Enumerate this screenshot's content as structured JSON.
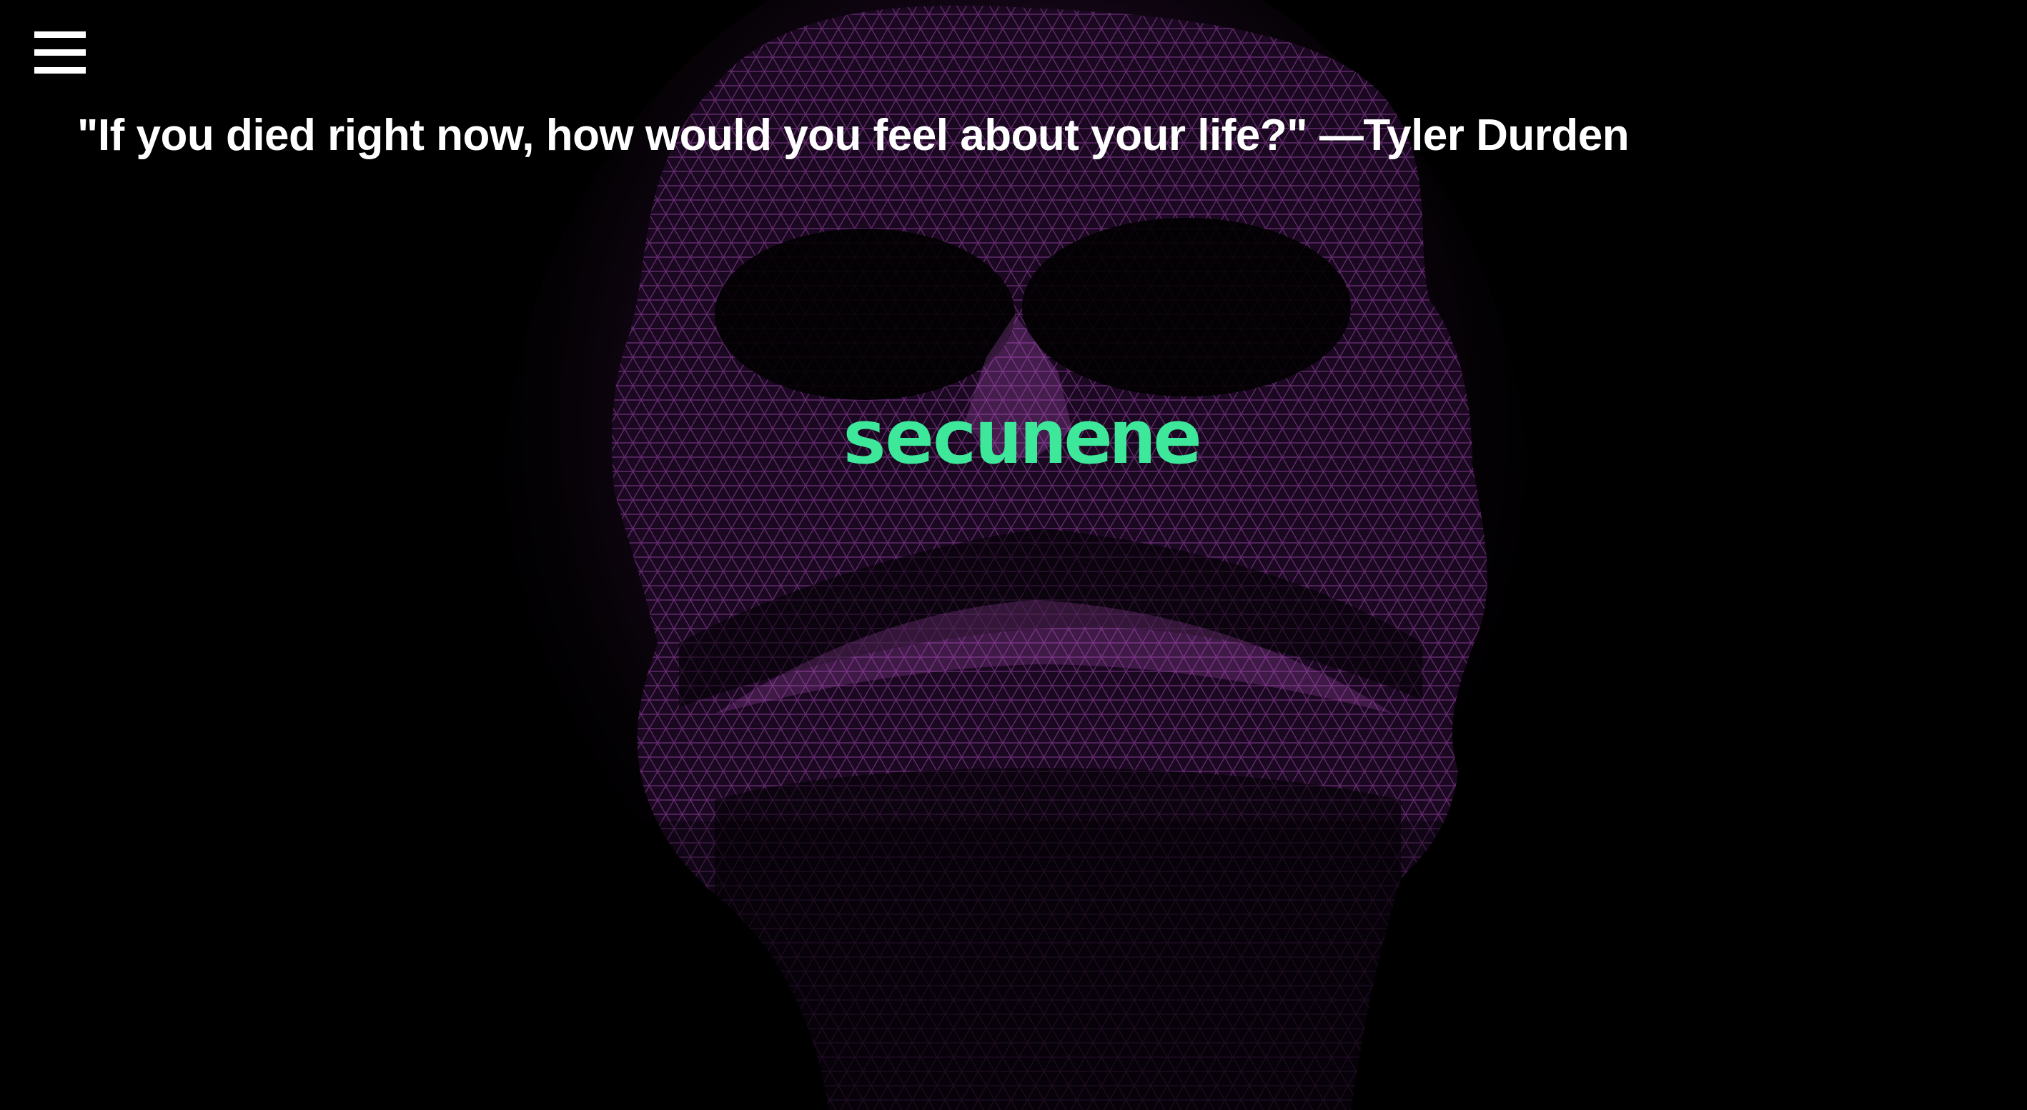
{
  "header": {
    "menu_icon": "hamburger-menu-icon",
    "quote_text": "\"If you died right now, how would you feel about your life?\" —Tyler Durden"
  },
  "brand": {
    "logo_text": "secunene",
    "logo_color": "#3ee89a"
  },
  "background": {
    "art": "wireframe-skull-illustration",
    "mesh_color": "#b84fc9",
    "page_color": "#000000"
  }
}
